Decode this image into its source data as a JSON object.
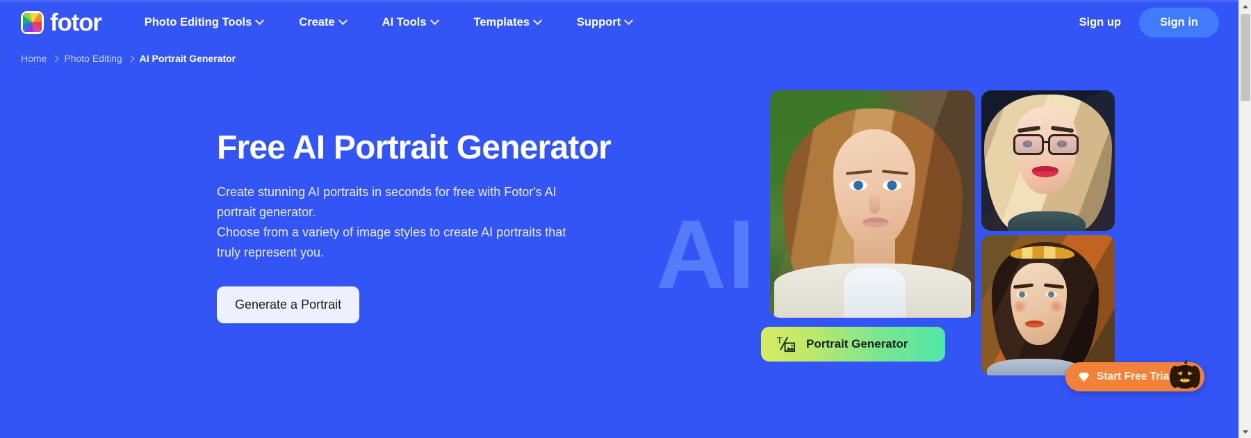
{
  "theme": {
    "background": "#3355f6",
    "accent_blue": "#3f7bfa",
    "cta_bg": "#eef1fb",
    "badge_gradient_start": "#d6ec62",
    "badge_gradient_end": "#4fe6a6",
    "trial_orange": "#f2813a",
    "watermark_color": "#5b82fb"
  },
  "header": {
    "logo_text": "fotor",
    "logo_icon": "fotor-pinwheel-icon",
    "nav": [
      {
        "label": "Photo Editing Tools",
        "has_dropdown": true
      },
      {
        "label": "Create",
        "has_dropdown": true
      },
      {
        "label": "AI Tools",
        "has_dropdown": true
      },
      {
        "label": "Templates",
        "has_dropdown": true
      },
      {
        "label": "Support",
        "has_dropdown": true
      }
    ],
    "sign_up_label": "Sign up",
    "sign_in_label": "Sign in"
  },
  "breadcrumb": {
    "items": [
      {
        "label": "Home",
        "current": false
      },
      {
        "label": "Photo Editing",
        "current": false
      },
      {
        "label": "AI Portrait Generator",
        "current": true
      }
    ]
  },
  "hero": {
    "title": "Free AI Portrait Generator",
    "paragraph_line1": "Create stunning AI portraits in seconds for free with Fotor's AI",
    "paragraph_line2": "portrait generator.",
    "paragraph_line3": "Choose from a variety of image styles to create AI portraits that",
    "paragraph_line4": "truly represent you.",
    "cta_label": "Generate a Portrait",
    "watermark_text": "AI"
  },
  "gallery": {
    "images": [
      {
        "alt": "realistic portrait of woman with auburn hair in white blazer"
      },
      {
        "alt": "stylized illustration of blonde woman wearing glasses"
      },
      {
        "alt": "classical oil painting portrait of woman with golden floral crown"
      }
    ]
  },
  "badge": {
    "label": "Portrait Generator",
    "icon": "text-to-image-icon"
  },
  "trial": {
    "label": "Start Free Trial",
    "icon": "gem-icon",
    "mascot": "jack-o-lantern-pumpkin-icon"
  },
  "scrollbar": {
    "up_arrow": "scroll-up-arrow-icon",
    "down_arrow": "scroll-down-arrow-icon"
  }
}
